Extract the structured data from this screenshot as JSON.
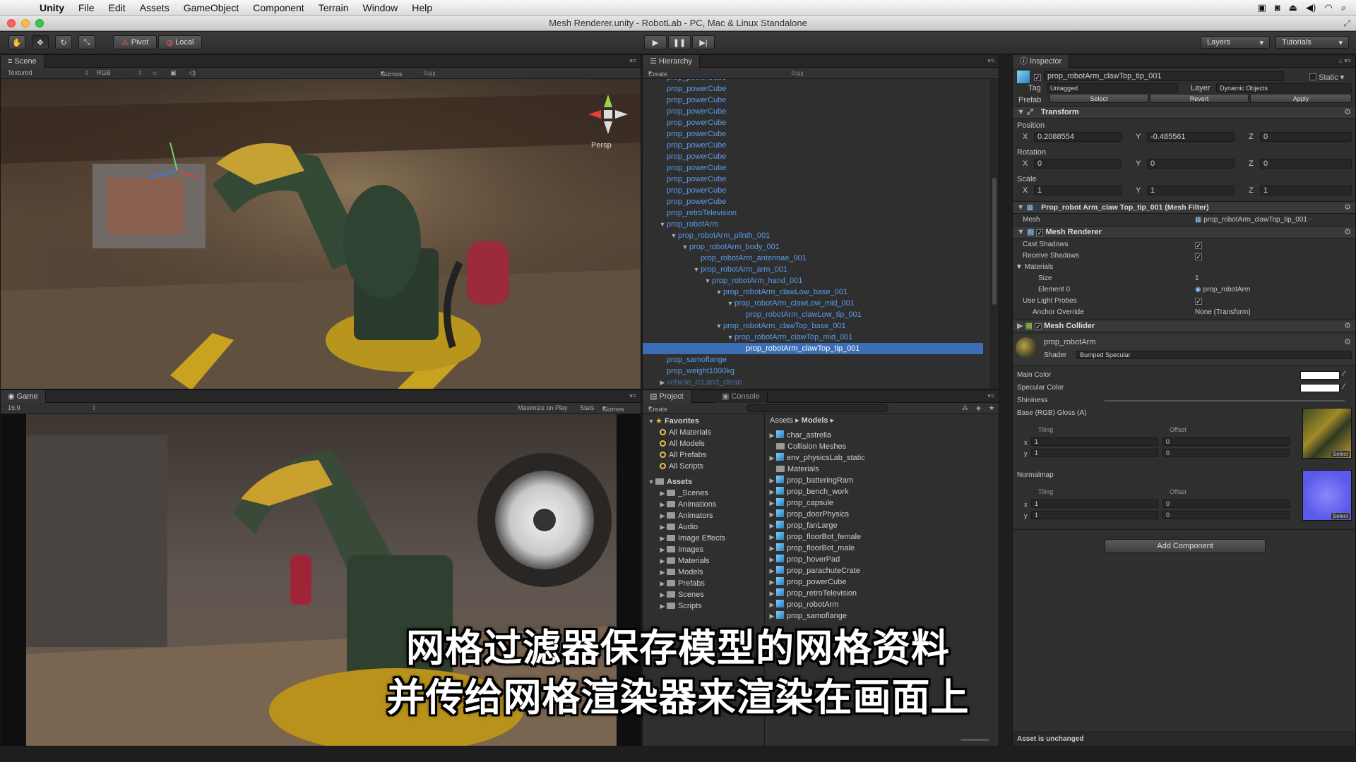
{
  "menubar": {
    "items": [
      "Unity",
      "File",
      "Edit",
      "Assets",
      "GameObject",
      "Component",
      "Terrain",
      "Window",
      "Help"
    ]
  },
  "window": {
    "title": "Mesh Renderer.unity - RobotLab - PC, Mac & Linux Standalone"
  },
  "toolbar": {
    "pivot": "Pivot",
    "local": "Local",
    "layers": "Layers",
    "tutorials": "Tutorials"
  },
  "scene": {
    "tab": "Scene",
    "shading": "Textured",
    "rgb": "RGB",
    "gizmos": "Gizmos",
    "search": "All",
    "persp": "Persp"
  },
  "game": {
    "tab": "Game",
    "aspect": "16:9",
    "maximize": "Maximize on Play",
    "stats": "Stats",
    "gizmos": "Gizmos"
  },
  "hierarchy": {
    "tab": "Hierarchy",
    "create": "Create",
    "search": "All",
    "rows": [
      {
        "label": "prop_powerCube",
        "indent": 0,
        "tri": ""
      },
      {
        "label": "prop_powerCube",
        "indent": 0,
        "tri": ""
      },
      {
        "label": "prop_powerCube",
        "indent": 0,
        "tri": ""
      },
      {
        "label": "prop_powerCube",
        "indent": 0,
        "tri": ""
      },
      {
        "label": "prop_powerCube",
        "indent": 0,
        "tri": ""
      },
      {
        "label": "prop_powerCube",
        "indent": 0,
        "tri": ""
      },
      {
        "label": "prop_powerCube",
        "indent": 0,
        "tri": ""
      },
      {
        "label": "prop_powerCube",
        "indent": 0,
        "tri": ""
      },
      {
        "label": "prop_powerCube",
        "indent": 0,
        "tri": ""
      },
      {
        "label": "prop_powerCube",
        "indent": 0,
        "tri": ""
      },
      {
        "label": "prop_powerCube",
        "indent": 0,
        "tri": ""
      },
      {
        "label": "prop_powerCube",
        "indent": 0,
        "tri": ""
      },
      {
        "label": "prop_retroTelevision",
        "indent": 0,
        "tri": ""
      },
      {
        "label": "prop_robotArm",
        "indent": 0,
        "tri": "▼"
      },
      {
        "label": "prop_robotArm_plinth_001",
        "indent": 1,
        "tri": "▼"
      },
      {
        "label": "prop_robotArm_body_001",
        "indent": 2,
        "tri": "▼"
      },
      {
        "label": "prop_robotArm_antennae_001",
        "indent": 3,
        "tri": ""
      },
      {
        "label": "prop_robotArm_arm_001",
        "indent": 3,
        "tri": "▼"
      },
      {
        "label": "prop_robotArm_hand_001",
        "indent": 4,
        "tri": "▼"
      },
      {
        "label": "prop_robotArm_clawLow_base_001",
        "indent": 5,
        "tri": "▼"
      },
      {
        "label": "prop_robotArm_clawLow_mid_001",
        "indent": 6,
        "tri": "▼"
      },
      {
        "label": "prop_robotArm_clawLow_tip_001",
        "indent": 7,
        "tri": ""
      },
      {
        "label": "prop_robotArm_clawTop_base_001",
        "indent": 5,
        "tri": "▼"
      },
      {
        "label": "prop_robotArm_clawTop_mid_001",
        "indent": 6,
        "tri": "▼"
      },
      {
        "label": "prop_robotArm_clawTop_tip_001",
        "indent": 7,
        "tri": "",
        "selected": true
      },
      {
        "label": "prop_samoflange",
        "indent": 0,
        "tri": ""
      },
      {
        "label": "prop_weight1000kg",
        "indent": 0,
        "tri": ""
      },
      {
        "label": "vehicle_rcLand_clean",
        "indent": 0,
        "tri": "▶",
        "dim": true
      }
    ]
  },
  "project": {
    "tab": "Project",
    "console_tab": "Console",
    "create": "Create",
    "favorites_label": "Favorites",
    "favorites": [
      "All Materials",
      "All Models",
      "All Prefabs",
      "All Scripts"
    ],
    "assets_label": "Assets",
    "folders": [
      "_Scenes",
      "Animations",
      "Animators",
      "Audio",
      "Image Effects",
      "Images",
      "Materials",
      "Models",
      "Prefabs",
      "Scenes",
      "Scripts"
    ],
    "breadcrumb": {
      "root": "Assets",
      "current": "Models"
    },
    "items": [
      {
        "label": "char_astrella",
        "kind": "cube"
      },
      {
        "label": "Collision Meshes",
        "kind": "folder"
      },
      {
        "label": "env_physicsLab_static",
        "kind": "cube"
      },
      {
        "label": "Materials",
        "kind": "folder"
      },
      {
        "label": "prop_batteringRam",
        "kind": "cube"
      },
      {
        "label": "prop_bench_work",
        "kind": "cube"
      },
      {
        "label": "prop_capsule",
        "kind": "cube"
      },
      {
        "label": "prop_doorPhysics",
        "kind": "cube"
      },
      {
        "label": "prop_fanLarge",
        "kind": "cube"
      },
      {
        "label": "prop_floorBot_female",
        "kind": "cube"
      },
      {
        "label": "prop_floorBot_male",
        "kind": "cube"
      },
      {
        "label": "prop_hoverPad",
        "kind": "cube"
      },
      {
        "label": "prop_parachuteCrate",
        "kind": "cube"
      },
      {
        "label": "prop_powerCube",
        "kind": "cube"
      },
      {
        "label": "prop_retroTelevision",
        "kind": "cube"
      },
      {
        "label": "prop_robotArm",
        "kind": "cube"
      },
      {
        "label": "prop_samoflange",
        "kind": "cube"
      }
    ]
  },
  "inspector": {
    "tab": "Inspector",
    "object_name": "prop_robotArm_clawTop_tip_001",
    "static": "Static",
    "tag_label": "Tag",
    "tag": "Untagged",
    "layer_label": "Layer",
    "layer": "Dynamic Objects",
    "prefab_label": "Prefab",
    "select": "Select",
    "revert": "Revert",
    "apply": "Apply",
    "transform": {
      "title": "Transform",
      "position_label": "Position",
      "position": {
        "x": "0.2088554",
        "y": "-0.485561",
        "z": "0"
      },
      "rotation_label": "Rotation",
      "rotation": {
        "x": "0",
        "y": "0",
        "z": "0"
      },
      "scale_label": "Scale",
      "scale": {
        "x": "1",
        "y": "1",
        "z": "1"
      }
    },
    "mesh_filter": {
      "title": "Prop_robot Arm_claw Top_tip_001 (Mesh Filter)",
      "mesh_label": "Mesh",
      "mesh": "prop_robotArm_clawTop_tip_001"
    },
    "mesh_renderer": {
      "title": "Mesh Renderer",
      "cast_shadows": "Cast Shadows",
      "receive_shadows": "Receive Shadows",
      "materials": "Materials",
      "size_label": "Size",
      "size": "1",
      "element0_label": "Element 0",
      "element0": "prop_robotArm",
      "light_probes": "Use Light Probes",
      "anchor_label": "Anchor Override",
      "anchor": "None (Transform)"
    },
    "mesh_collider": {
      "title": "Mesh Collider"
    },
    "material": {
      "name": "prop_robotArm",
      "shader_label": "Shader",
      "shader": "Bumped Specular",
      "main_color": "Main Color",
      "specular_color": "Specular Color",
      "shininess": "Shininess",
      "base_label": "Base (RGB) Gloss (A)",
      "tiling": "Tiling",
      "offset": "Offset",
      "base_tiling": {
        "x": "1",
        "y": "1"
      },
      "base_offset": {
        "x": "0",
        "y": "0"
      },
      "normalmap_label": "Normalmap",
      "normal_tiling": {
        "x": "1",
        "y": "1"
      },
      "normal_offset": {
        "x": "0",
        "y": "0"
      },
      "select": "Select"
    },
    "add_component": "Add Component",
    "status": "Asset is unchanged"
  },
  "subtitle": {
    "line1": "网格过滤器保存模型的网格资料",
    "line2": "并传给网格渲染器来渲染在画面上"
  },
  "colors": {
    "selection": "#3b6eb5",
    "prefab_text": "#5a9be8",
    "panel_bg": "#2f2f2f"
  }
}
